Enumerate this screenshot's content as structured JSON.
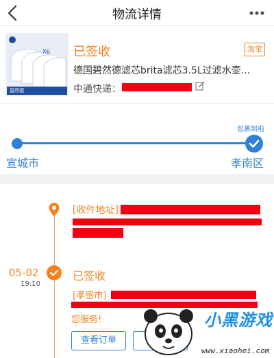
{
  "header": {
    "title": "物流详情",
    "back_icon": "chevron-left-icon",
    "more_icon": "more-dots-icon"
  },
  "order": {
    "status": "已签收",
    "platform_badge": "淘宝",
    "product_name": "德国碧然德滤芯brita滤芯3.5L过滤水壶...",
    "courier_label": "中通快递：",
    "thumbnail": {
      "pack_count": "X6",
      "tagline": "碧然德"
    }
  },
  "progress": {
    "arrived_tag": "包裹到啦",
    "from_city": "宣城市",
    "to_city": "孝南区"
  },
  "timeline": {
    "address_label": "[收件地址]",
    "events": [
      {
        "date": "05-02",
        "time": "19:10",
        "title": "已签收",
        "location": "[孝感市]",
        "tail": "您服务!"
      }
    ]
  },
  "actions": {
    "view_order": "查看订单"
  },
  "watermark": {
    "brand": "小黑游戏",
    "url": "www.xiaohei.com"
  },
  "colors": {
    "accent_orange": "#f5821f",
    "accent_blue": "#2f80d9",
    "redaction": "#f20012"
  }
}
